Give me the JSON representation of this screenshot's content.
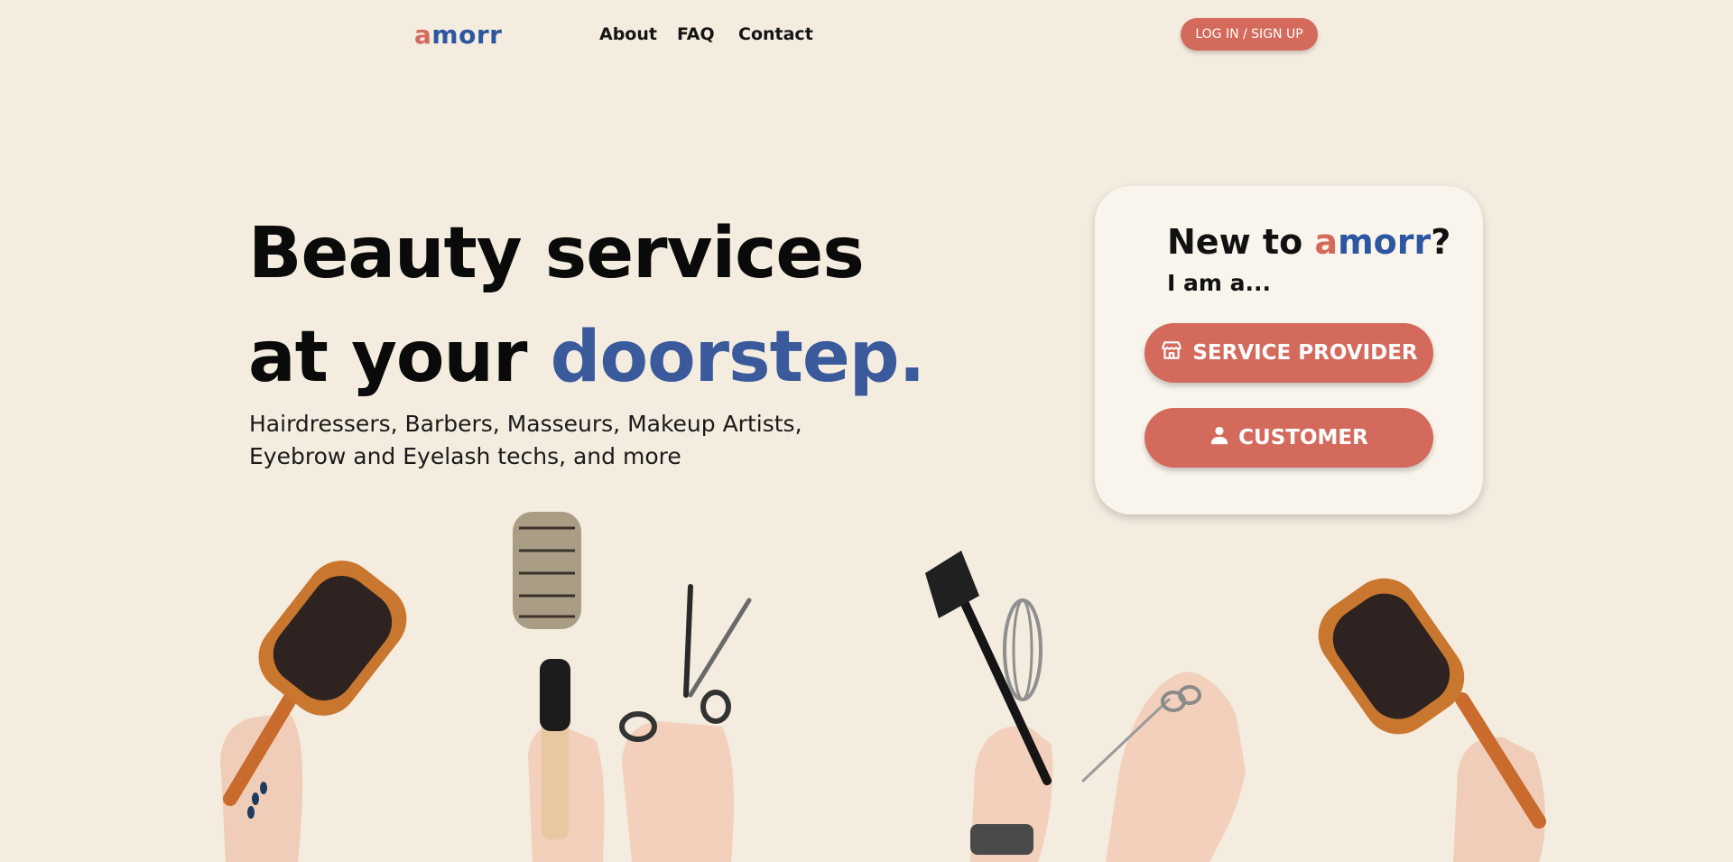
{
  "nav": {
    "logo_first": "a",
    "logo_rest": "morr",
    "links": [
      "About",
      "FAQ",
      "Contact"
    ],
    "login_label": "LOG IN / SIGN UP"
  },
  "hero": {
    "line1": "Beauty services",
    "line2_prefix": "at your ",
    "line2_accent": "doorstep.",
    "sub1": "Hairdressers, Barbers, Masseurs, Makeup Artists,",
    "sub2": "Eyebrow and Eyelash techs, and more"
  },
  "card": {
    "title_prefix": "New to ",
    "title_brand_first": "a",
    "title_brand_rest": "morr",
    "title_suffix": "?",
    "subtitle": "I am a...",
    "provider_label": "SERVICE PROVIDER",
    "provider_icon": "storefront-icon",
    "customer_label": "CUSTOMER",
    "customer_icon": "person-icon"
  },
  "colors": {
    "background": "#f4ecdf",
    "accent_coral": "#d46a5c",
    "brand_blue": "#2d56a0",
    "hero_blue": "#3a5a9c",
    "card_bg": "#f9f5ec"
  }
}
